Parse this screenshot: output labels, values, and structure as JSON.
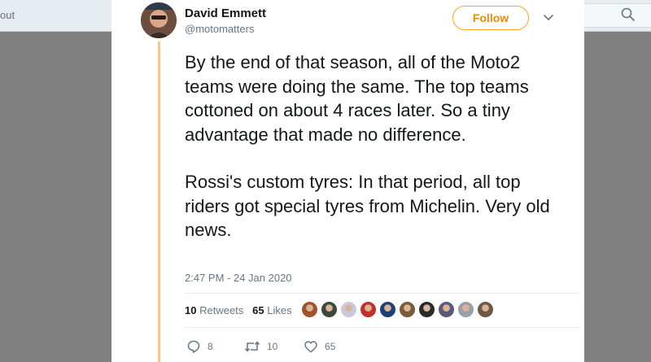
{
  "topbar": {
    "left_text": "out"
  },
  "tweet": {
    "author_name": "David Emmett",
    "author_handle": "@motomatters",
    "follow_label": "Follow",
    "paragraph1": "By the end of that season, all of the Moto2 teams were doing the same. The top teams cottoned on about 4 races later. So a tiny advantage that made no difference.",
    "paragraph2": "Rossi's custom tyres: In that period, all top riders got special tyres from Michelin. Very old news.",
    "timestamp": "2:47 PM - 24 Jan 2020"
  },
  "stats": {
    "retweets_count": "10",
    "retweets_label": "Retweets",
    "likes_count": "65",
    "likes_label": "Likes"
  },
  "likers": [
    {
      "color": "#a0522d"
    },
    {
      "color": "#3b4a3b"
    },
    {
      "color": "#c9c9d8"
    },
    {
      "color": "#c0302a"
    },
    {
      "color": "#1f3f7a"
    },
    {
      "color": "#7a5a3a"
    },
    {
      "color": "#2a2a2a"
    },
    {
      "color": "#5a5a78"
    },
    {
      "color": "#9aa0a8"
    },
    {
      "color": "#6b5a48"
    }
  ],
  "actions": {
    "reply_count": "8",
    "retweet_count": "10",
    "like_count": "65"
  },
  "colors": {
    "accent": "#f5a623",
    "thread_line": "#f0c99a",
    "text": "#14171a",
    "muted": "#657786"
  }
}
